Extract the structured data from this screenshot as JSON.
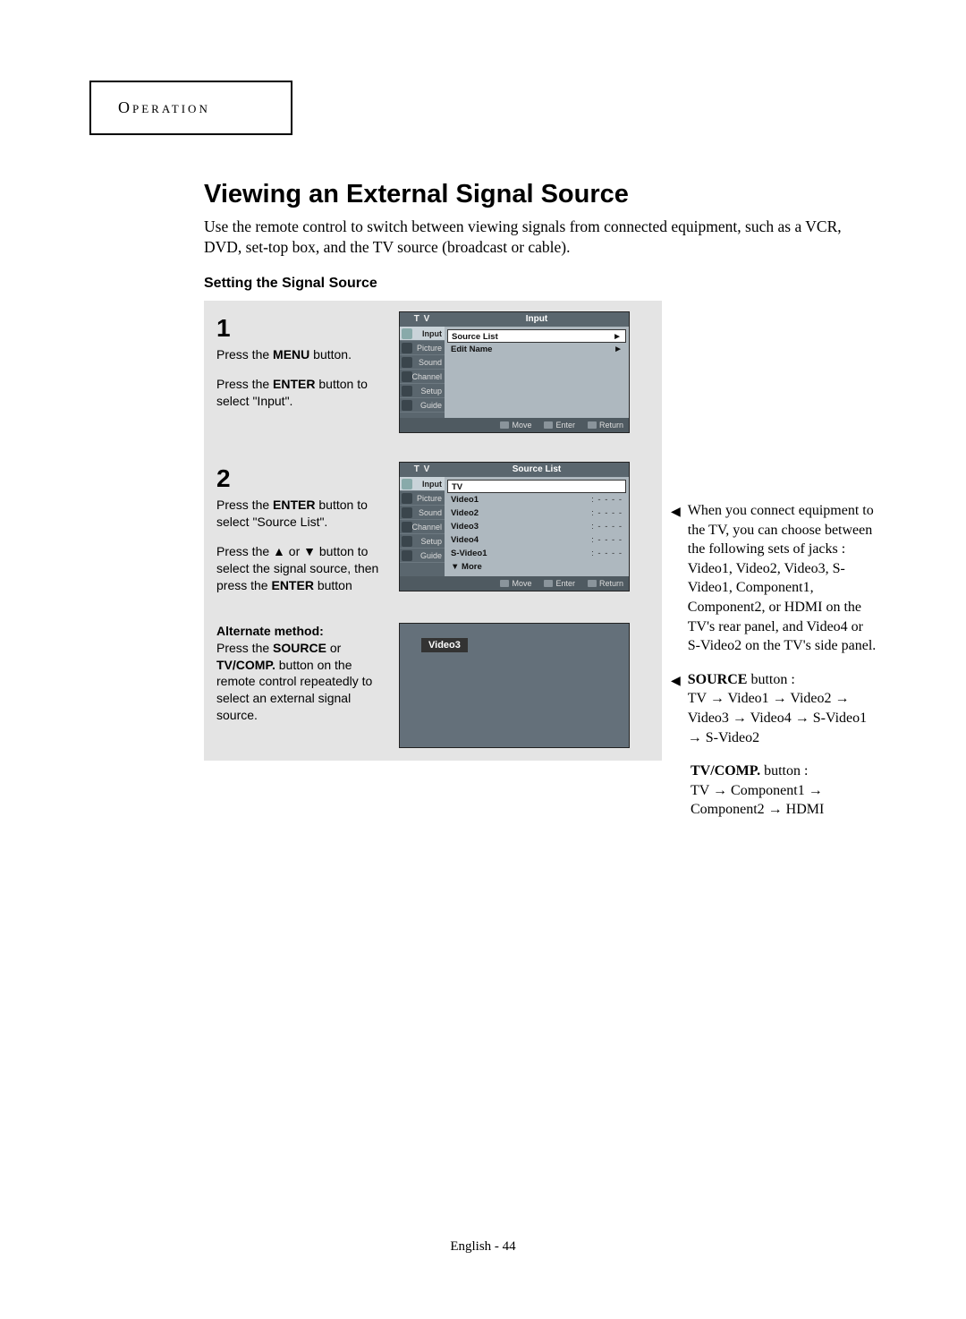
{
  "section": "Operation",
  "title": "Viewing an External Signal Source",
  "intro": "Use the remote control to switch between viewing signals from connected equipment, such as a VCR, DVD, set-top box, and the TV source (broadcast or cable).",
  "subtitle": "Setting the Signal Source",
  "step1": {
    "num": "1",
    "line1a": "Press the ",
    "line1b": "MENU",
    "line1c": " button.",
    "line2a": "Press the ",
    "line2b": "ENTER",
    "line2c": " button to select \"Input\"."
  },
  "osd1": {
    "hdr_left": "T V",
    "hdr_right": "Input",
    "side": [
      "Input",
      "Picture",
      "Sound",
      "Channel",
      "Setup",
      "Guide"
    ],
    "rows": [
      {
        "label": "Source List",
        "right": "►",
        "hl": true
      },
      {
        "label": "Edit Name",
        "right": "►"
      }
    ],
    "footer": [
      "Move",
      "Enter",
      "Return"
    ]
  },
  "step2": {
    "num": "2",
    "line1a": "Press the ",
    "line1b": "ENTER",
    "line1c": " button to select \"Source List\".",
    "line2a": "Press the ",
    "up": "▲",
    "line2b": " or ",
    "down": "▼",
    "line2c": " button to select the signal source, then press the ",
    "line2d": "ENTER",
    "line2e": " button"
  },
  "osd2": {
    "hdr_left": "T V",
    "hdr_right": "Source List",
    "side": [
      "Input",
      "Picture",
      "Sound",
      "Channel",
      "Setup",
      "Guide"
    ],
    "rows": [
      {
        "label": "TV",
        "right": "",
        "hl": true
      },
      {
        "label": "Video1",
        "right": ": - - - -"
      },
      {
        "label": "Video2",
        "right": ": - - - -"
      },
      {
        "label": "Video3",
        "right": ": - - - -"
      },
      {
        "label": "Video4",
        "right": ": - - - -"
      },
      {
        "label": "S-Video1",
        "right": ": - - - -"
      },
      {
        "label": "▼ More",
        "right": ""
      }
    ],
    "footer": [
      "Move",
      "Enter",
      "Return"
    ]
  },
  "alt": {
    "heading": "Alternate method:",
    "a": "Press the ",
    "b": "SOURCE",
    "c": " or ",
    "d": "TV/COMP.",
    "e": " button on the remote control repeatedly to select an external signal source."
  },
  "osd3_label": "Video3",
  "note1": "When you connect equipment to the TV, you can choose between the following sets of jacks : Video1, Video2, Video3, S-Video1, Component1, Component2, or HDMI on the TV's rear panel, and Video4 or S-Video2 on the TV's side panel.",
  "note2": {
    "b": "SOURCE",
    "t1": " button :",
    "seq": "TV → Video1 → Video2 → Video3  → Video4 → S-Video1 → S-Video2"
  },
  "note3": {
    "b": "TV/COMP.",
    "t1": " button :",
    "seq": "TV → Component1 → Component2 → HDMI"
  },
  "footer": "English - 44"
}
